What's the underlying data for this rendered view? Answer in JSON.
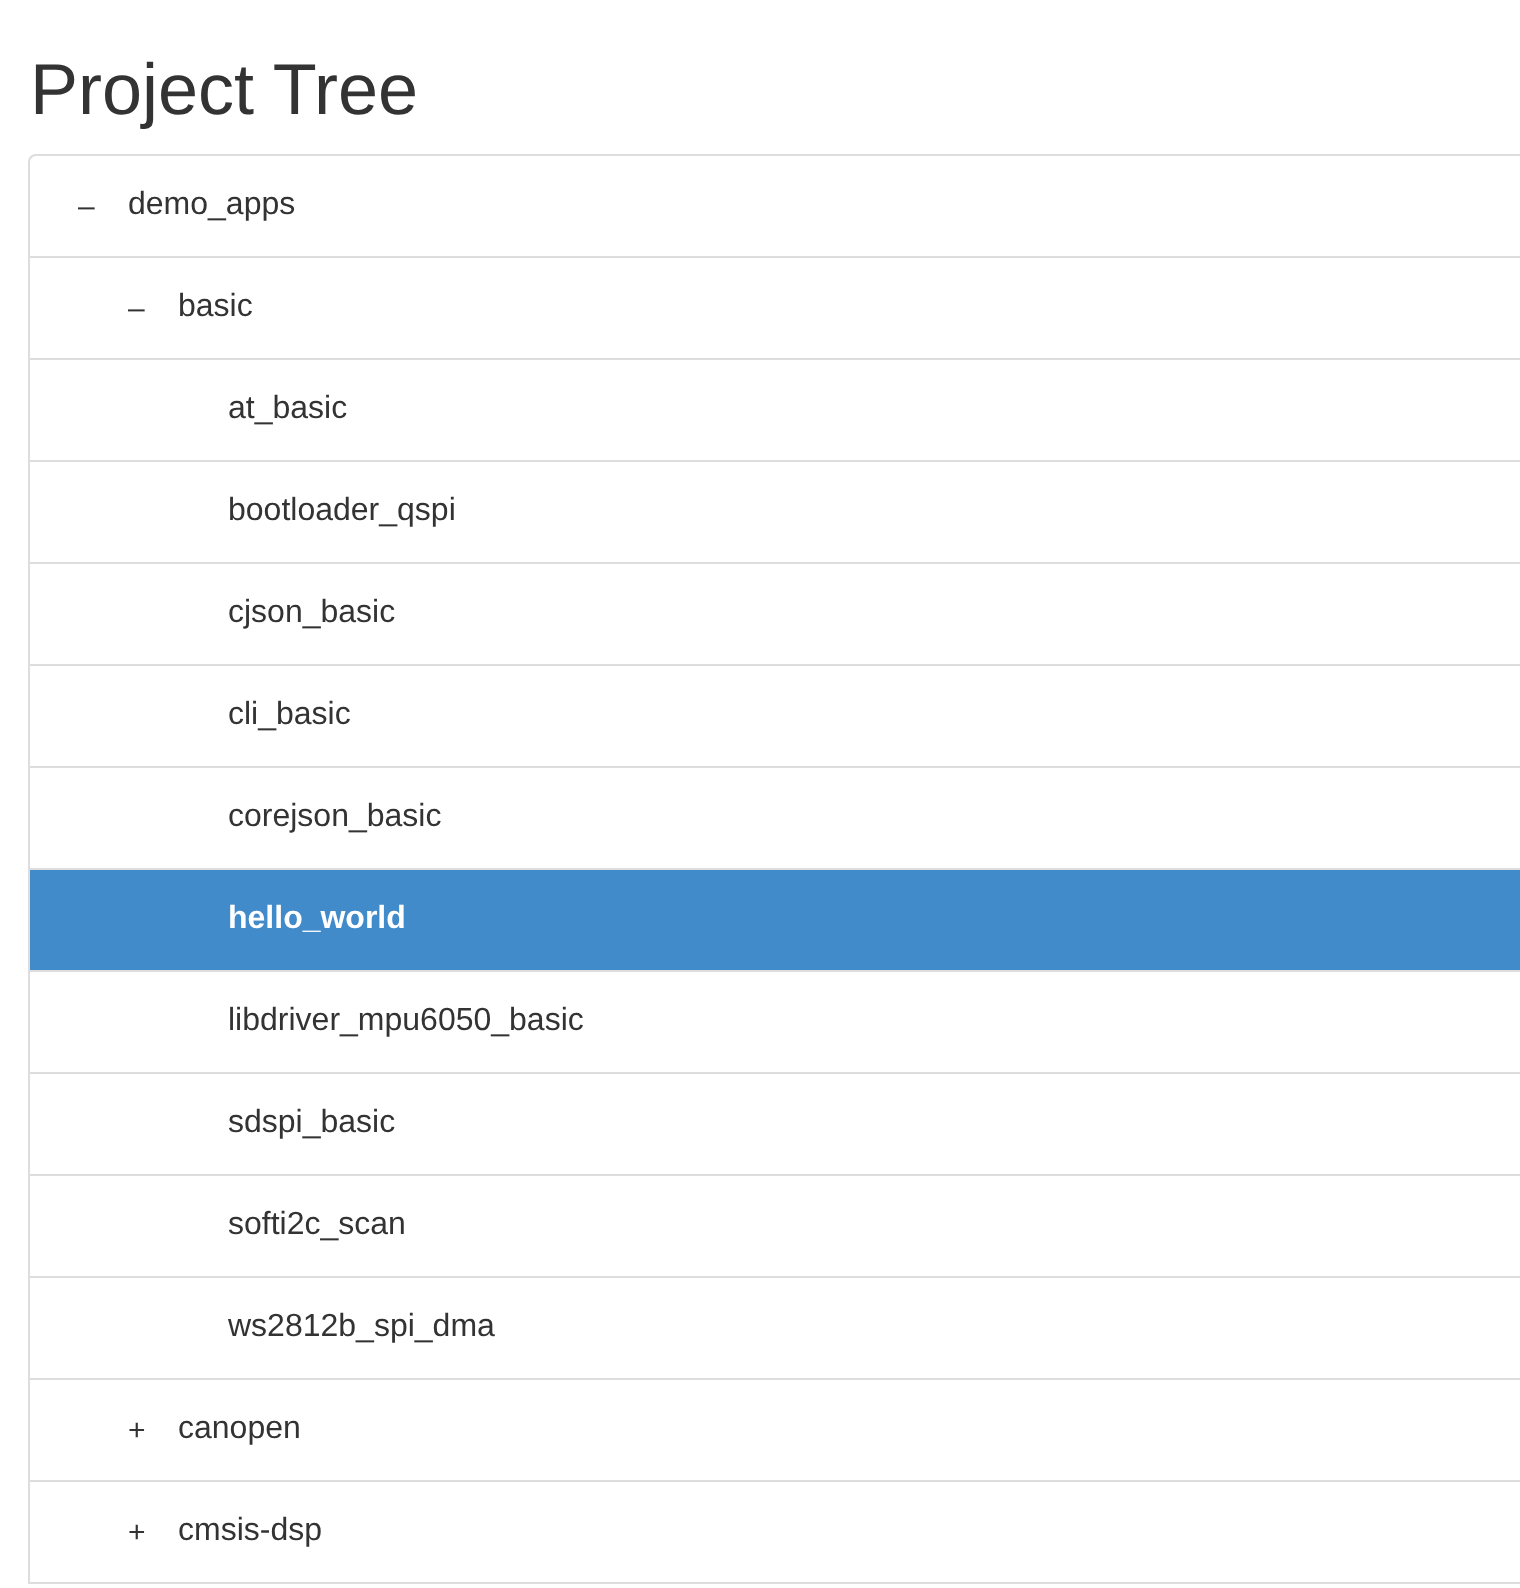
{
  "title": "Project Tree",
  "tree": [
    {
      "label": "demo_apps",
      "toggle": "–",
      "selected": false,
      "children": [
        {
          "label": "basic",
          "toggle": "–",
          "selected": false,
          "children": [
            {
              "label": "at_basic",
              "selected": false
            },
            {
              "label": "bootloader_qspi",
              "selected": false
            },
            {
              "label": "cjson_basic",
              "selected": false
            },
            {
              "label": "cli_basic",
              "selected": false
            },
            {
              "label": "corejson_basic",
              "selected": false
            },
            {
              "label": "hello_world",
              "selected": true
            },
            {
              "label": "libdriver_mpu6050_basic",
              "selected": false
            },
            {
              "label": "sdspi_basic",
              "selected": false
            },
            {
              "label": "softi2c_scan",
              "selected": false
            },
            {
              "label": "ws2812b_spi_dma",
              "selected": false
            }
          ]
        },
        {
          "label": "canopen",
          "toggle": "+",
          "selected": false
        },
        {
          "label": "cmsis-dsp",
          "toggle": "+",
          "selected": false
        }
      ]
    }
  ]
}
